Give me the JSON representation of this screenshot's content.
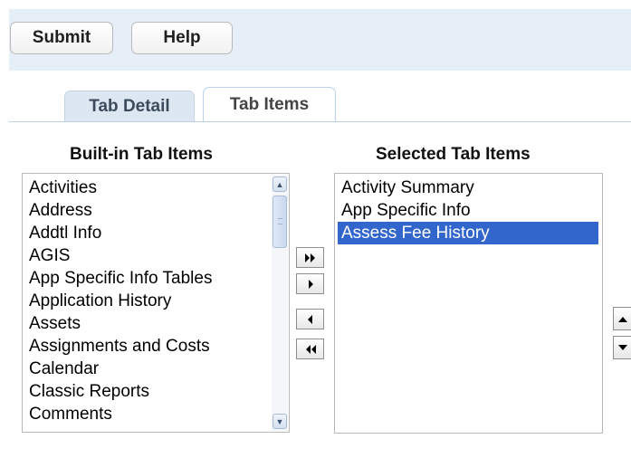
{
  "toolbar": {
    "submit_label": "Submit",
    "help_label": "Help"
  },
  "tabs": [
    {
      "label": "Tab Detail",
      "active": false
    },
    {
      "label": "Tab Items",
      "active": true
    }
  ],
  "builtin": {
    "heading": "Built-in Tab Items",
    "items": [
      "Activities",
      "Address",
      "Addtl Info",
      "AGIS",
      "App Specific Info Tables",
      "Application History",
      "Assets",
      "Assignments and Costs",
      "Calendar",
      "Classic Reports",
      "Comments"
    ]
  },
  "selected": {
    "heading": "Selected Tab Items",
    "items": [
      "Activity Summary",
      "App Specific Info",
      "Assess Fee History"
    ],
    "selected_item": "Assess Fee History"
  },
  "move_buttons": [
    "move-all-right-icon",
    "move-right-icon",
    "move-left-icon",
    "move-all-left-icon"
  ],
  "order_buttons": [
    "move-up-icon",
    "move-down-icon"
  ],
  "colors": {
    "selection": "#3366cc",
    "toolbar_bg": "#e6eef8"
  }
}
